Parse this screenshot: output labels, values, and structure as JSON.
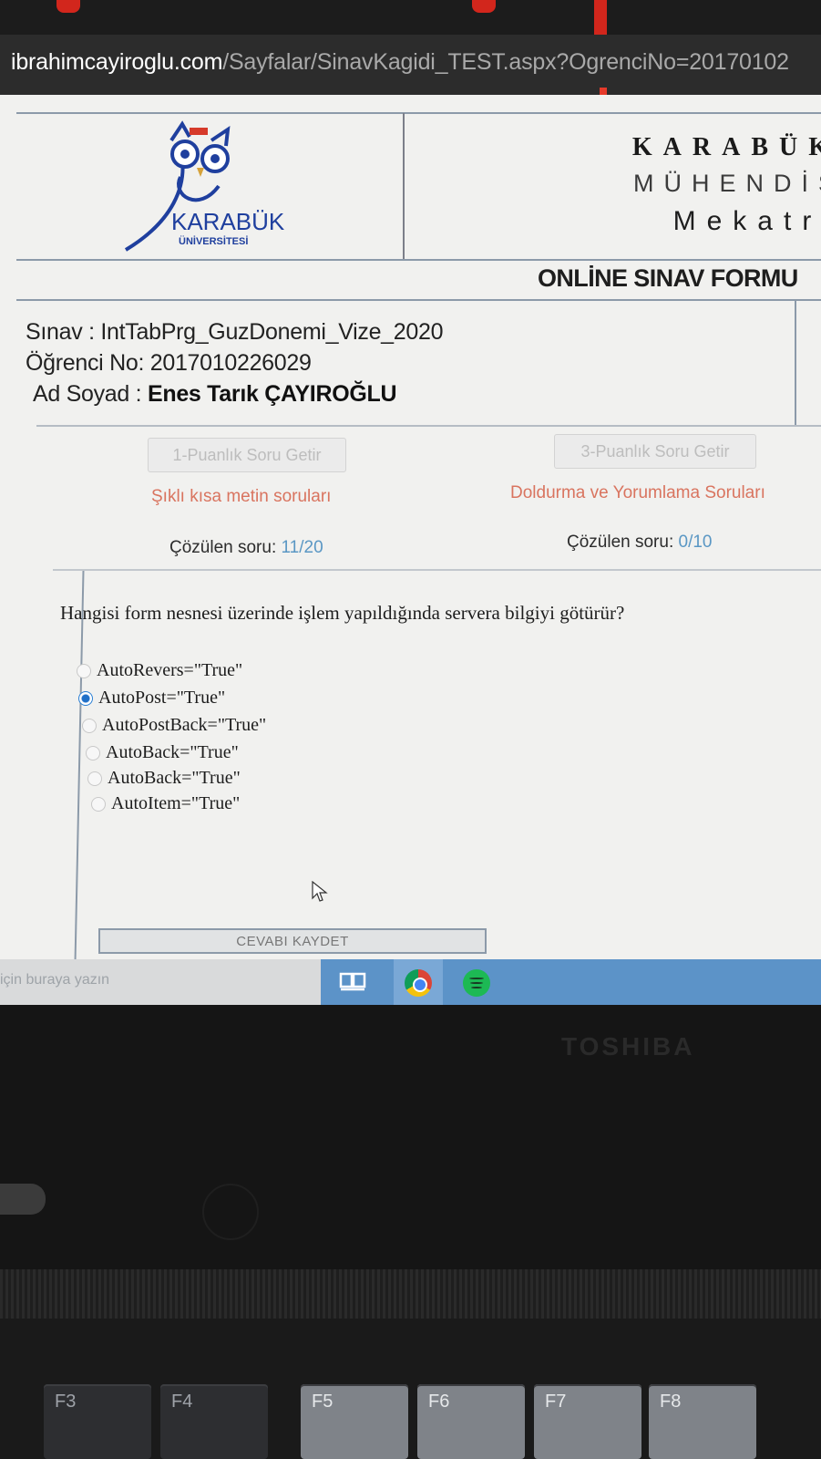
{
  "browser": {
    "url_host": "ibrahimcayiroglu.com",
    "url_path": "/Sayfalar/SinavKagidi_TEST.aspx?OgrenciNo=20170102"
  },
  "header": {
    "university_line": "KARABÜK",
    "faculty_line": "MÜHENDİS",
    "department_line": "Mekatro",
    "logo_text": "KARABÜK",
    "logo_subtext": "ÜNİVERSİTESİ",
    "form_title": "ONLİNE SINAV FORMU"
  },
  "exam_info": {
    "exam_label": "Sınav :",
    "exam_value": "IntTabPrg_GuzDonemi_Vize_2020",
    "student_no_label": "Öğrenci No:",
    "student_no_value": "2017010226029",
    "name_label": "Ad Soyad :",
    "name_value": "Enes Tarık ÇAYIROĞLU"
  },
  "question_sets": [
    {
      "button": "1-Puanlık Soru Getir",
      "category": "Şıklı kısa metin soruları",
      "solved_label": "Çözülen soru:",
      "solved_value": "11/20"
    },
    {
      "button": "3-Puanlık Soru Getir",
      "category": "Doldurma ve Yorumlama Soruları",
      "solved_label": "Çözülen soru:",
      "solved_value": "0/10"
    }
  ],
  "question": {
    "text": "Hangisi form nesnesi üzerinde işlem yapıldığında servera bilgiyi götürür?",
    "options": [
      {
        "label": "AutoRevers=\"True\"",
        "selected": false
      },
      {
        "label": "AutoPost=\"True\"",
        "selected": true
      },
      {
        "label": "AutoPostBack=\"True\"",
        "selected": false
      },
      {
        "label": "AutoBack=\"True\"",
        "selected": false
      },
      {
        "label": "AutoBack=\"True\"",
        "selected": false
      },
      {
        "label": "AutoItem=\"True\"",
        "selected": false
      }
    ],
    "save_button": "CEVABI KAYDET"
  },
  "taskbar": {
    "search_placeholder": "için buraya yazın"
  },
  "laptop": {
    "brand": "TOSHIBA",
    "keys": [
      "F3",
      "F4",
      "F5",
      "F6",
      "F7",
      "F8"
    ]
  },
  "colors": {
    "accent_red": "#d9745f",
    "link_blue": "#5a97c4",
    "taskbar_blue": "#5c93c8",
    "selected_radio": "#2070c8"
  }
}
